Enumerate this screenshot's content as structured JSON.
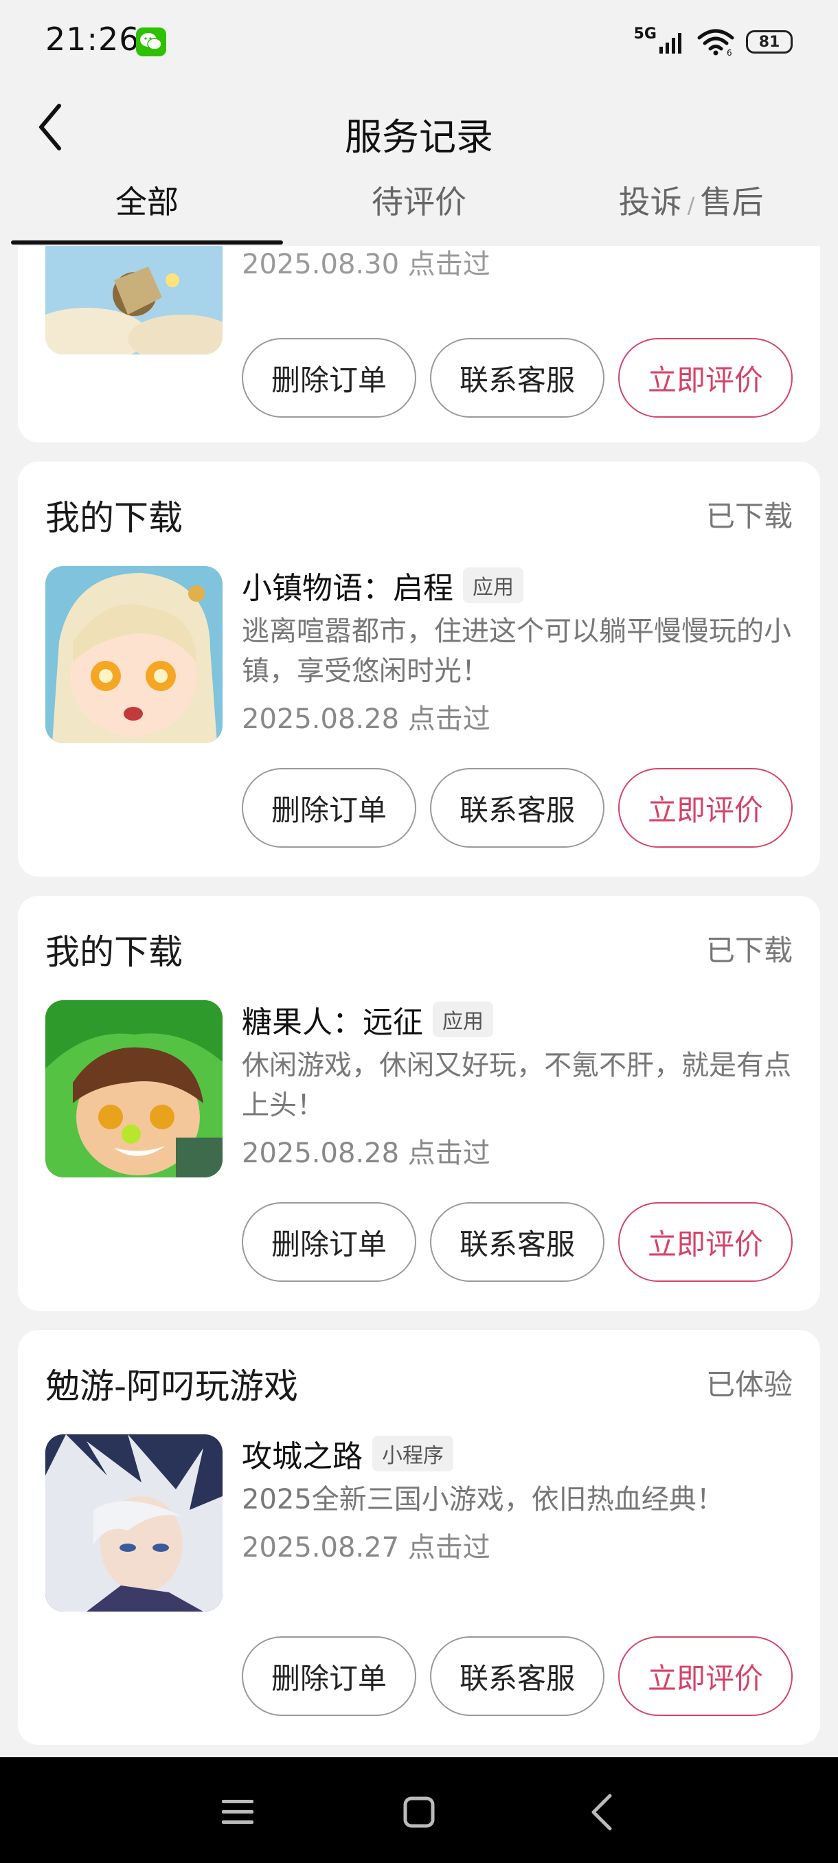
{
  "status_bar": {
    "time": "21:26",
    "network": "5G",
    "battery": "81",
    "icons": [
      "wechat-icon",
      "signal-icon",
      "wifi-icon",
      "battery-icon"
    ]
  },
  "header": {
    "title": "服务记录",
    "back_icon": "chevron-left-icon"
  },
  "tabs": [
    {
      "label": "全部",
      "active": true
    },
    {
      "label": "待评价",
      "active": false
    },
    {
      "label": "投诉",
      "sep": "/",
      "label2": "售后",
      "active": false
    }
  ],
  "cards": [
    {
      "partial": true,
      "date": "2025.08.30 点击过",
      "actions": {
        "delete": "删除订单",
        "contact": "联系客服",
        "review": "立即评价"
      }
    },
    {
      "source": "我的下载",
      "status": "已下载",
      "app_name": "小镇物语：启程",
      "tag": "应用",
      "description": "逃离喧嚣都市，住进这个可以躺平慢慢玩的小镇，享受悠闲时光！",
      "date": "2025.08.28 点击过",
      "actions": {
        "delete": "删除订单",
        "contact": "联系客服",
        "review": "立即评价"
      }
    },
    {
      "source": "我的下载",
      "status": "已下载",
      "app_name": "糖果人：远征",
      "tag": "应用",
      "description": "休闲游戏，休闲又好玩，不氪不肝，就是有点上头！",
      "date": "2025.08.28 点击过",
      "actions": {
        "delete": "删除订单",
        "contact": "联系客服",
        "review": "立即评价"
      }
    },
    {
      "source": "勉游-阿叼玩游戏",
      "status": "已体验",
      "app_name": "攻城之路",
      "tag": "小程序",
      "description": "2025全新三国小游戏，依旧热血经典！",
      "date": "2025.08.27 点击过",
      "actions": {
        "delete": "删除订单",
        "contact": "联系客服",
        "review": "立即评价"
      }
    }
  ],
  "colors": {
    "accent": "#d6436a",
    "background": "#f2f2f2",
    "card": "#ffffff"
  },
  "navbar": {
    "icons": [
      "menu-icon",
      "home-square-icon",
      "back-triangle-icon"
    ]
  }
}
